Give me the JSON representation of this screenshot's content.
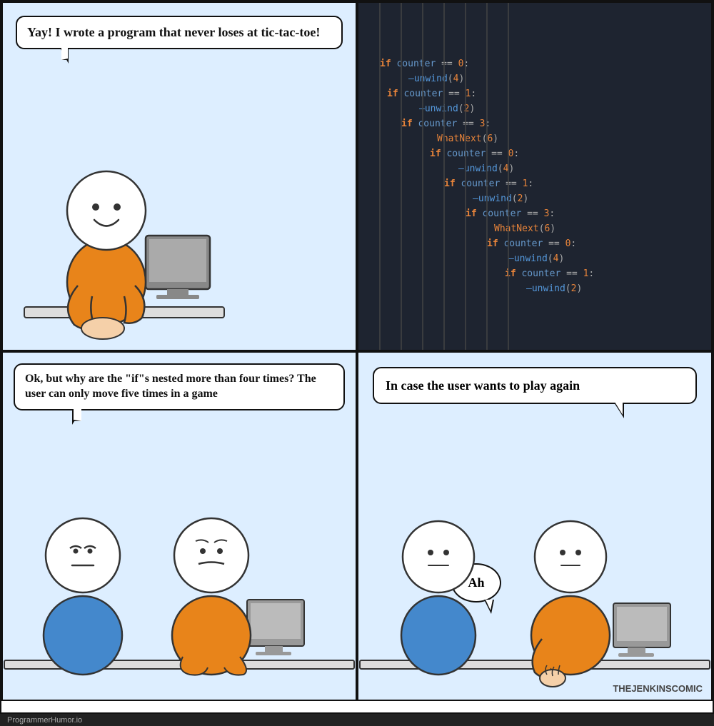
{
  "panels": {
    "panel1": {
      "speech": "Yay! I wrote a program that never loses at tic-tac-toe!"
    },
    "panel2": {
      "code_lines": [
        {
          "indent": 0,
          "text": "if counter == 0:"
        },
        {
          "indent": 1,
          "text": "—unwind(4)"
        },
        {
          "indent": 0,
          "text": "if counter == 1:"
        },
        {
          "indent": 1,
          "text": "—unwind(2)"
        },
        {
          "indent": 0,
          "text": "if counter == 3:"
        },
        {
          "indent": 1,
          "text": "WhatNext(6)"
        },
        {
          "indent": 0,
          "text": "if counter == 0:"
        },
        {
          "indent": 1,
          "text": "—unwind(4)"
        },
        {
          "indent": 0,
          "text": "if counter == 1:"
        },
        {
          "indent": 1,
          "text": "—unwind(2)"
        },
        {
          "indent": 0,
          "text": "if counter == 3:"
        },
        {
          "indent": 1,
          "text": "WhatNext(6)"
        },
        {
          "indent": 0,
          "text": "if counter == 0:"
        },
        {
          "indent": 1,
          "text": "—unwind(4)"
        },
        {
          "indent": 0,
          "text": "if counter == 1:"
        },
        {
          "indent": 1,
          "text": "—unwind(2)"
        }
      ]
    },
    "panel3": {
      "speech": "Ok, but why are the \"if\"s nested more than four times? The user can only move five times in a game"
    },
    "panel4": {
      "speech_main": "In case the user wants to play again",
      "speech_ah": "Ah"
    }
  },
  "footer": {
    "left": "ProgrammerHumor.io",
    "attribution": "THEJENKINSCOMIC"
  }
}
